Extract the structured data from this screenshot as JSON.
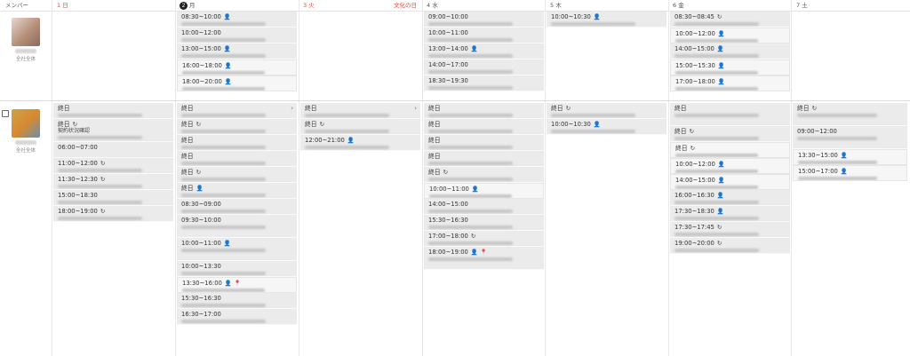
{
  "header": {
    "member_label": "メンバー",
    "days": [
      {
        "label": "1 日",
        "red": true
      },
      {
        "label": "2 月",
        "today": true,
        "num": "2",
        "name": "月"
      },
      {
        "label": "3 火",
        "red": true,
        "holiday": "文化の日"
      },
      {
        "label": "4 水"
      },
      {
        "label": "5 木"
      },
      {
        "label": "6 金"
      },
      {
        "label": "7 土"
      }
    ]
  },
  "members": [
    {
      "role": "全社全体"
    },
    {
      "role": "全社全体"
    }
  ],
  "row1": {
    "mon": [
      {
        "time": "08:30~10:00",
        "icon": "👤"
      },
      {
        "time": "10:00~12:00",
        "icon": ""
      },
      {
        "time": "13:00~15:00",
        "icon": "👤"
      },
      {
        "time": "16:00~18:00",
        "icon": "👤",
        "white": true
      },
      {
        "time": "18:00~20:00",
        "icon": "👤",
        "white": true
      }
    ],
    "wed": [
      {
        "time": "09:00~10:00"
      },
      {
        "time": "10:00~11:00"
      },
      {
        "time": "13:00~14:00",
        "icon": "👤"
      },
      {
        "time": "14:00~17:00"
      },
      {
        "time": "18:30~19:30"
      }
    ],
    "thu": [
      {
        "time": "10:00~10:30",
        "icon": "👤"
      }
    ],
    "fri": [
      {
        "time": "08:30~08:45",
        "icon": "↻"
      },
      {
        "time": "10:00~12:00",
        "icon": "👤",
        "white": true
      },
      {
        "time": "14:00~15:00",
        "icon": "👤"
      },
      {
        "time": "15:00~15:30",
        "icon": "👤",
        "white": true
      },
      {
        "time": "17:00~18:00",
        "icon": "👤",
        "white": true
      }
    ]
  },
  "row2": {
    "sun": [
      {
        "time": "終日"
      },
      {
        "time": "終日",
        "icon": "↻",
        "note": "契約状況確認",
        "tall": true
      },
      {
        "time": "06:00~07:00",
        "noblur": true
      },
      {
        "time": "11:00~12:00",
        "icon": "↻"
      },
      {
        "time": "11:30~12:30",
        "icon": "↻"
      },
      {
        "time": "15:00~18:30"
      },
      {
        "time": "18:00~19:00",
        "icon": "↻"
      }
    ],
    "mon": [
      {
        "time": "終日",
        "arrow": "›"
      },
      {
        "time": "終日",
        "icon": "↻"
      },
      {
        "time": "終日"
      },
      {
        "time": "終日"
      },
      {
        "time": "終日",
        "icon": "↻"
      },
      {
        "time": "終日",
        "icon": "👤"
      },
      {
        "time": "08:30~09:00"
      },
      {
        "time": "09:30~10:00",
        "tall": true
      },
      {
        "time": "10:00~11:00",
        "icon": "👤",
        "tall": true
      },
      {
        "time": "10:00~13:30"
      },
      {
        "time": "13:30~16:00",
        "icon": "👤 📍",
        "white": true
      },
      {
        "time": "15:30~16:30"
      },
      {
        "time": "16:30~17:00"
      }
    ],
    "tue": [
      {
        "time": "終日",
        "arrow": "›"
      },
      {
        "time": "終日",
        "icon": "↻"
      },
      {
        "time": "12:00~21:00",
        "icon": "👤"
      }
    ],
    "wed": [
      {
        "time": "終日"
      },
      {
        "time": "終日"
      },
      {
        "time": "終日"
      },
      {
        "time": "終日"
      },
      {
        "time": "終日",
        "icon": "↻"
      },
      {
        "time": "10:00~11:00",
        "icon": "👤",
        "white": true
      },
      {
        "time": "14:00~15:00"
      },
      {
        "time": "15:30~16:30"
      },
      {
        "time": "17:00~18:00",
        "icon": "↻"
      },
      {
        "time": "18:00~19:00",
        "icon": "👤 📍",
        "tall": true
      }
    ],
    "thu": [
      {
        "time": "終日",
        "icon": "↻"
      },
      {
        "time": "10:00~10:30",
        "icon": "👤"
      }
    ],
    "fri": [
      {
        "time": "終日",
        "tall": true
      },
      {
        "time": "終日",
        "icon": "↻"
      },
      {
        "time": "終日",
        "icon": "↻",
        "white": true
      },
      {
        "time": "10:00~12:00",
        "icon": "👤",
        "white": true
      },
      {
        "time": "14:00~15:00",
        "icon": "👤",
        "white": true
      },
      {
        "time": "16:00~16:30",
        "icon": "👤"
      },
      {
        "time": "17:30~18:30",
        "icon": "👤"
      },
      {
        "time": "17:30~17:45",
        "icon": "↻"
      },
      {
        "time": "19:00~20:00",
        "icon": "↻"
      }
    ],
    "sat": [
      {
        "time": "終日",
        "icon": "↻",
        "tall": true
      },
      {
        "time": "09:00~12:00",
        "tall": true
      },
      {
        "time": "13:30~15:00",
        "icon": "👤",
        "white": true
      },
      {
        "time": "15:00~17:00",
        "icon": "👤",
        "white": true
      }
    ]
  }
}
